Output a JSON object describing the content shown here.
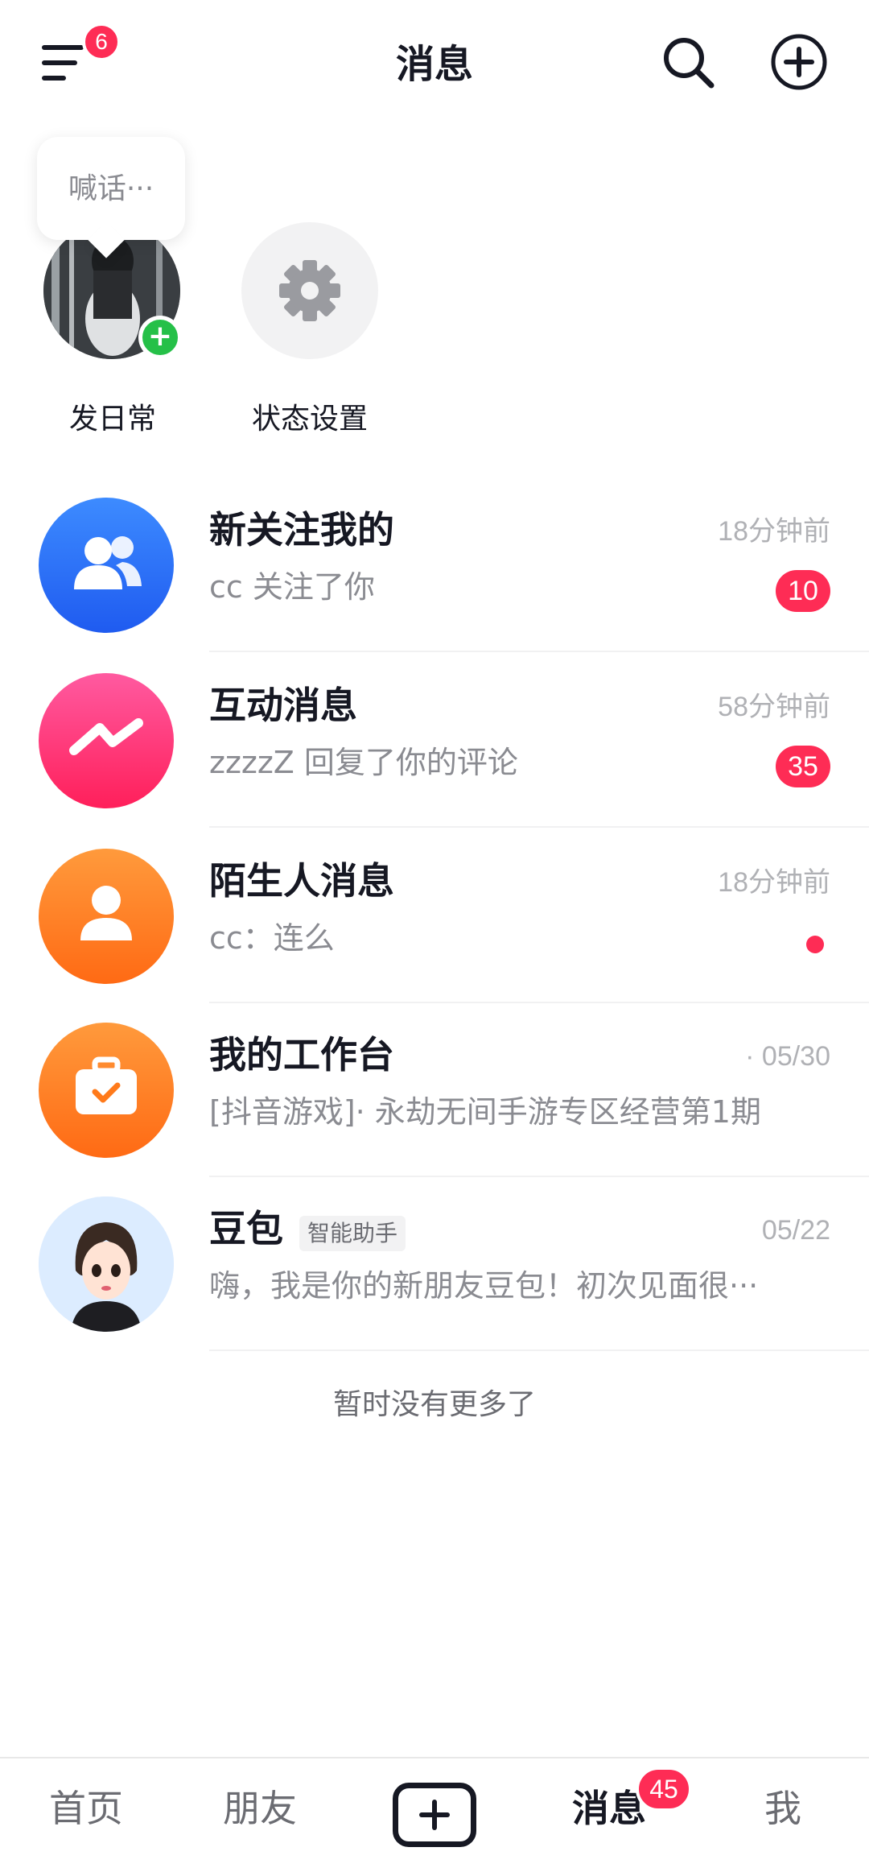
{
  "header": {
    "title": "消息",
    "menu_badge": "6",
    "menu_icon": "menu-icon",
    "search_icon": "search-icon",
    "add_icon": "plus-circle-icon"
  },
  "stories": {
    "bubble_text": "喊话···",
    "items": [
      {
        "label": "发日常",
        "icon": "user-avatar"
      },
      {
        "label": "状态设置",
        "icon": "gear-icon"
      }
    ]
  },
  "conversations": [
    {
      "title": "新关注我的",
      "preview": "cc 关注了你",
      "time": "18分钟前",
      "badge": "10",
      "icon": "users-icon",
      "color": "#2d6bff"
    },
    {
      "title": "互动消息",
      "preview": "zzzzZ 回复了你的评论",
      "time": "58分钟前",
      "badge": "35",
      "icon": "lightning-icon",
      "color": "#ff2d6f"
    },
    {
      "title": "陌生人消息",
      "preview": "cc：连么",
      "time": "18分钟前",
      "dot": true,
      "icon": "person-icon",
      "color": "#ff7a1a"
    },
    {
      "title": "我的工作台",
      "preview": "[抖音游戏]· 永劫无间手游专区经营第1期",
      "time": "· 05/30",
      "icon": "briefcase-icon",
      "color": "#ff7a1a"
    },
    {
      "title": "豆包",
      "tag": "智能助手",
      "preview": "嗨，我是你的新朋友豆包！初次见面很···",
      "time": "05/22",
      "icon": "doubao-avatar",
      "color": "#dcecff"
    }
  ],
  "footer_text": "暂时没有更多了",
  "bottom_nav": {
    "items": [
      "首页",
      "朋友",
      "消息",
      "我"
    ],
    "create_icon": "plus-square-icon",
    "messages_badge": "45"
  }
}
